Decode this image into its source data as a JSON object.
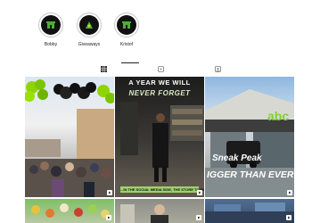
{
  "highlights": [
    {
      "label": "Bobby",
      "icon": "store-icon"
    },
    {
      "label": "Giveaways",
      "icon": "gift-icon"
    },
    {
      "label": "Kristof",
      "icon": "store-icon"
    }
  ],
  "tabs": [
    "posts-grid-icon",
    "reels-icon",
    "tagged-icon"
  ],
  "posts": {
    "reel2": {
      "line1": "A YEAR WE WILL",
      "line2": "NEVER FORGET",
      "caption": "...IN THE SOCIAL MEDIA SIDE, THE STORE TO FILM CONTENT"
    },
    "reel3": {
      "line1": "Sneak Peak",
      "line2": "IGGER THAN EVER!",
      "sign": "abc"
    }
  },
  "colors": {
    "brand_green": "#4cae36",
    "accent_lime": "#b8e03e"
  }
}
